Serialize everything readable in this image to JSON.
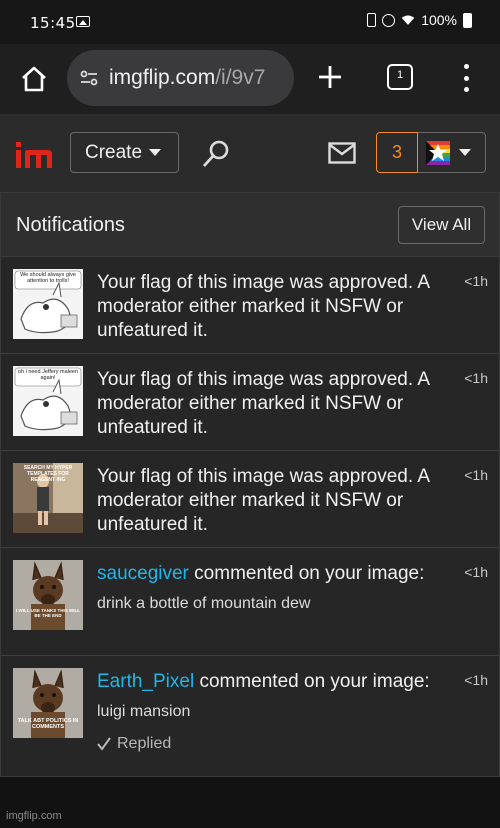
{
  "status_bar": {
    "time": "15:45",
    "battery": "100%"
  },
  "browser": {
    "url_host": "imgflip.com",
    "url_path": "/i/9v7",
    "tabs_count": "1"
  },
  "header": {
    "create_label": "Create",
    "notif_count": "3"
  },
  "panel": {
    "title": "Notifications",
    "view_all_label": "View All"
  },
  "notifications": [
    {
      "text": "Your flag of this image was approved. A moderator either marked it NSFW or unfeatured it.",
      "time": "<1h",
      "thumb_caption": "We should always give attention to trolls!"
    },
    {
      "text": "Your flag of this image was approved. A moderator either marked it NSFW or unfeatured it.",
      "time": "<1h",
      "thumb_caption": "oh i need Jeffery maleen again!"
    },
    {
      "text": "Your flag of this image was approved. A moderator either marked it NSFW or unfeatured it.",
      "time": "<1h",
      "thumb_caption": "SEARCH MY HYPER TEMPLATES FOR REAGENT ING"
    },
    {
      "username": "saucegiver",
      "action": " commented on your image:",
      "comment": "drink a bottle of mountain dew",
      "time": "<1h",
      "thumb_caption": "I WILL USE TANKS THIS WILL BE THE END"
    },
    {
      "username": "Earth_Pixel",
      "action": " commented on your image:",
      "comment": "luigi mansion",
      "replied_label": "Replied",
      "time": "<1h",
      "thumb_caption": "TALK ABT POLITICS IN COMMENTS"
    }
  ],
  "watermark": "imgflip.com",
  "colors": {
    "accent": "#1fb7ea",
    "notif_orange": "#f68b1f",
    "logo_red": "#e0261b"
  }
}
